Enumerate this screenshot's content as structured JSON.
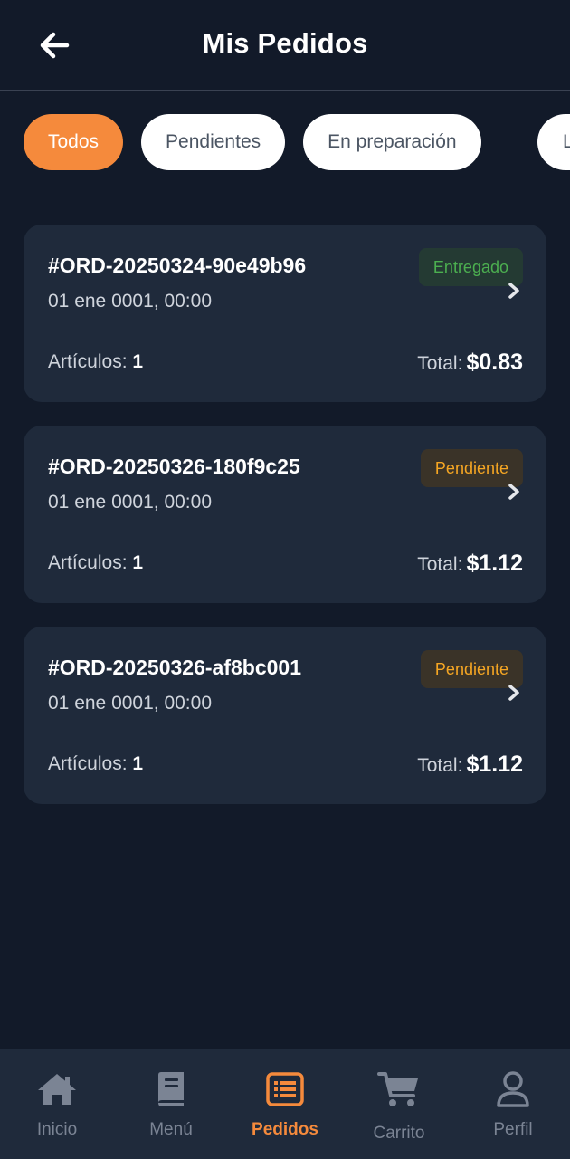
{
  "header": {
    "title": "Mis Pedidos",
    "back_icon": "arrow-left-icon"
  },
  "filters": [
    {
      "label": "Todos",
      "active": true
    },
    {
      "label": "Pendientes",
      "active": false
    },
    {
      "label": "En preparación",
      "active": false
    },
    {
      "label": "L",
      "active": false
    }
  ],
  "orders": [
    {
      "id": "#ORD-20250324-90e49b96",
      "date": "01 ene 0001, 00:00",
      "status": "Entregado",
      "status_type": "delivered",
      "items_label": "Artículos:",
      "items_count": "1",
      "total_label": "Total:",
      "total_value": "$0.83"
    },
    {
      "id": "#ORD-20250326-180f9c25",
      "date": "01 ene 0001, 00:00",
      "status": "Pendiente",
      "status_type": "pending",
      "items_label": "Artículos:",
      "items_count": "1",
      "total_label": "Total:",
      "total_value": "$1.12"
    },
    {
      "id": "#ORD-20250326-af8bc001",
      "date": "01 ene 0001, 00:00",
      "status": "Pendiente",
      "status_type": "pending",
      "items_label": "Artículos:",
      "items_count": "1",
      "total_label": "Total:",
      "total_value": "$1.12"
    }
  ],
  "nav": [
    {
      "label": "Inicio",
      "icon": "home-icon",
      "active": false
    },
    {
      "label": "Menú",
      "icon": "book-icon",
      "active": false
    },
    {
      "label": "Pedidos",
      "icon": "list-icon",
      "active": true
    },
    {
      "label": "Carrito",
      "icon": "cart-icon",
      "active": false
    },
    {
      "label": "Perfil",
      "icon": "user-icon",
      "active": false
    }
  ],
  "colors": {
    "background": "#121a29",
    "card": "#1f2a3b",
    "accent": "#f58a3c",
    "delivered": "#4caf50",
    "pending": "#f5a623"
  }
}
